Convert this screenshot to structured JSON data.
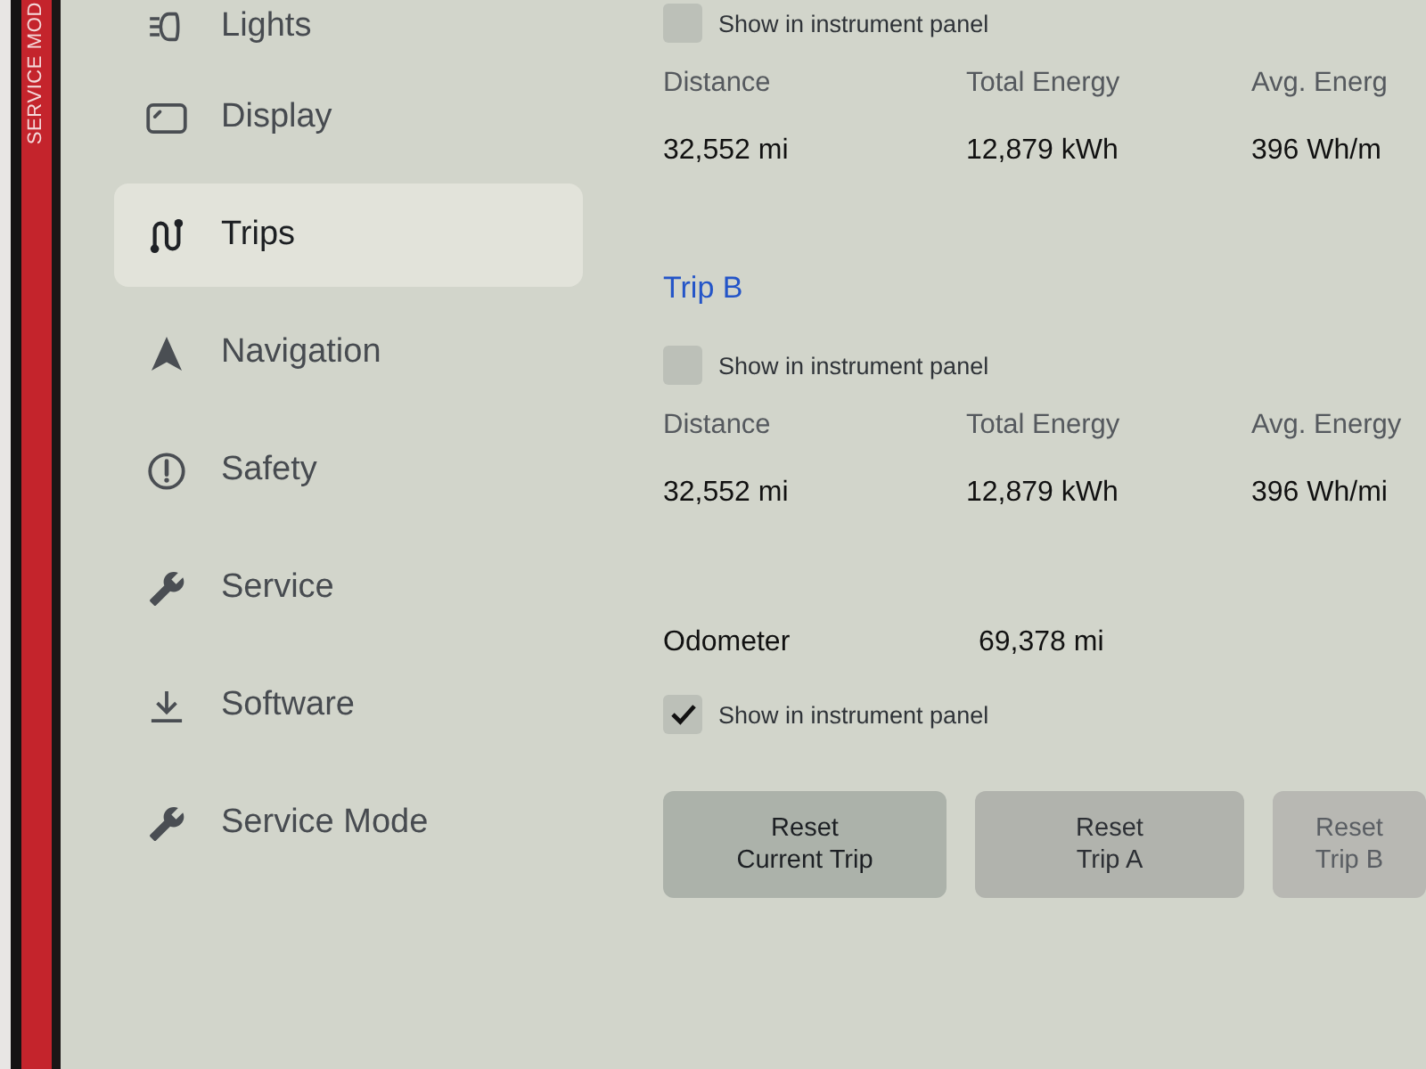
{
  "bezel": {
    "label": "SERVICE MOD"
  },
  "sidebar": {
    "items": [
      {
        "label": "Lights",
        "selected": false
      },
      {
        "label": "Display",
        "selected": false
      },
      {
        "label": "Trips",
        "selected": true
      },
      {
        "label": "Navigation",
        "selected": false
      },
      {
        "label": "Safety",
        "selected": false
      },
      {
        "label": "Service",
        "selected": false
      },
      {
        "label": "Software",
        "selected": false
      },
      {
        "label": "Service Mode",
        "selected": false
      }
    ]
  },
  "trips": [
    {
      "checkbox": {
        "label": "Show in instrument panel",
        "checked": false
      },
      "stats": [
        {
          "label": "Distance",
          "value": "32,552 mi"
        },
        {
          "label": "Total Energy",
          "value": "12,879 kWh"
        },
        {
          "label": "Avg. Energ",
          "value": "396 Wh/m"
        }
      ]
    },
    {
      "title": "Trip B",
      "checkbox": {
        "label": "Show in instrument panel",
        "checked": false
      },
      "stats": [
        {
          "label": "Distance",
          "value": "32,552 mi"
        },
        {
          "label": "Total Energy",
          "value": "12,879 kWh"
        },
        {
          "label": "Avg. Energy",
          "value": "396 Wh/mi"
        }
      ]
    }
  ],
  "odometer": {
    "label": "Odometer",
    "value": "69,378 mi",
    "checkbox": {
      "label": "Show in instrument panel",
      "checked": true
    }
  },
  "buttons": [
    {
      "lines": [
        "Reset",
        "Current Trip"
      ]
    },
    {
      "lines": [
        "Reset",
        "Trip A"
      ]
    },
    {
      "lines": [
        "Reset",
        "Trip B"
      ]
    }
  ]
}
